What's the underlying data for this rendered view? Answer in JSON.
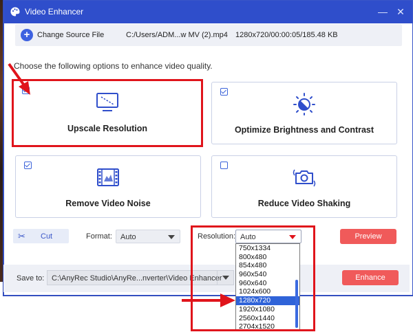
{
  "window": {
    "title": "Video Enhancer",
    "minimize_glyph": "—",
    "close_glyph": "✕"
  },
  "source": {
    "change_label": "Change Source File",
    "path": "C:/Users/ADM...w MV (2).mp4",
    "info": "1280x720/00:00:05/185.48 KB"
  },
  "instruction": "Choose the following options to enhance video quality.",
  "options": [
    {
      "label": "Upscale Resolution",
      "checked": true,
      "icon": "monitor-icon"
    },
    {
      "label": "Optimize Brightness and Contrast",
      "checked": true,
      "icon": "brightness-icon"
    },
    {
      "label": "Remove Video Noise",
      "checked": true,
      "icon": "film-icon"
    },
    {
      "label": "Reduce Video Shaking",
      "checked": false,
      "icon": "camera-icon"
    }
  ],
  "toolbar": {
    "cut_label": "Cut",
    "format_label": "Format:",
    "format_value": "Auto",
    "resolution_label": "Resolution:",
    "resolution_value": "Auto",
    "preview_label": "Preview"
  },
  "resolution_options": [
    "750x1334",
    "800x480",
    "854x480",
    "960x540",
    "960x640",
    "1024x600",
    "1280x720",
    "1920x1080",
    "2560x1440",
    "2704x1520"
  ],
  "resolution_selected": "1280x720",
  "save": {
    "label": "Save to:",
    "path": "C:\\AnyRec Studio\\AnyRe...nverter\\Video Enhancer",
    "enhance_label": "Enhance"
  },
  "colors": {
    "accent": "#2f4ecb",
    "highlight": "#e0141b",
    "action": "#f05a5a"
  }
}
